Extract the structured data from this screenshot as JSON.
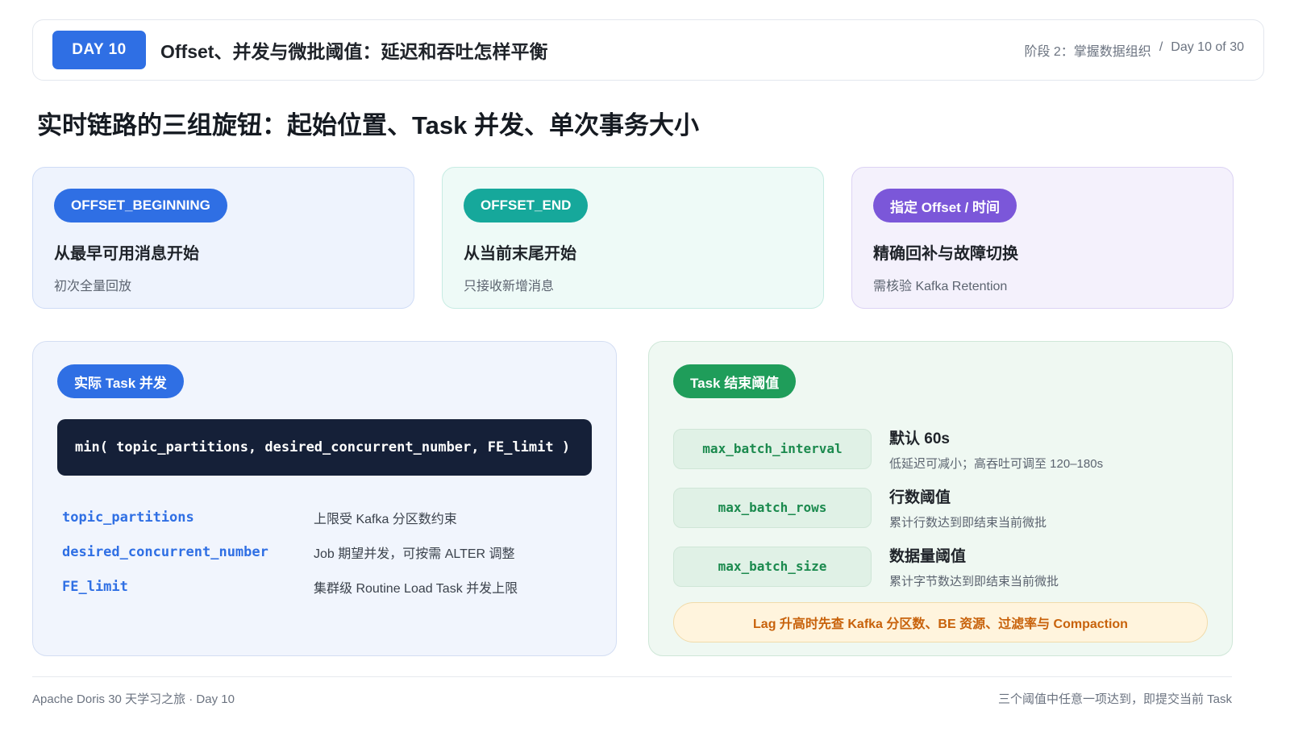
{
  "header": {
    "day_badge": "DAY 10",
    "title": "Offset、并发与微批阈值：延迟和吞吐怎样平衡",
    "stage": "阶段 2：掌握数据组织",
    "separator": "/",
    "progress": "Day 10 of 30"
  },
  "main_title": "实时链路的三组旋钮：起始位置、Task 并发、单次事务大小",
  "offset_cards": [
    {
      "tag": "OFFSET_BEGINNING",
      "heading": "从最早可用消息开始",
      "desc": "初次全量回放"
    },
    {
      "tag": "OFFSET_END",
      "heading": "从当前末尾开始",
      "desc": "只接收新增消息"
    },
    {
      "tag": "指定 Offset / 时间",
      "heading": "精确回补与故障切换",
      "desc": "需核验 Kafka Retention"
    }
  ],
  "concurrency": {
    "tag": "实际 Task 并发",
    "formula": "min( topic_partitions, desired_concurrent_number, FE_limit )",
    "params": [
      {
        "key": "topic_partitions",
        "desc": "上限受 Kafka 分区数约束"
      },
      {
        "key": "desired_concurrent_number",
        "desc": "Job 期望并发，可按需 ALTER 调整"
      },
      {
        "key": "FE_limit",
        "desc": "集群级 Routine Load Task 并发上限"
      }
    ]
  },
  "thresholds": {
    "tag": "Task 结束阈值",
    "items": [
      {
        "key": "max_batch_interval",
        "title": "默认 60s",
        "desc": "低延迟可减小；高吞吐可调至 120–180s"
      },
      {
        "key": "max_batch_rows",
        "title": "行数阈值",
        "desc": "累计行数达到即结束当前微批"
      },
      {
        "key": "max_batch_size",
        "title": "数据量阈值",
        "desc": "累计字节数达到即结束当前微批"
      }
    ],
    "lag_note": "Lag 升高时先查 Kafka 分区数、BE 资源、过滤率与 Compaction"
  },
  "footer": {
    "left": "Apache Doris 30 天学习之旅 · Day 10",
    "right": "三个阈值中任意一项达到，即提交当前 Task"
  }
}
